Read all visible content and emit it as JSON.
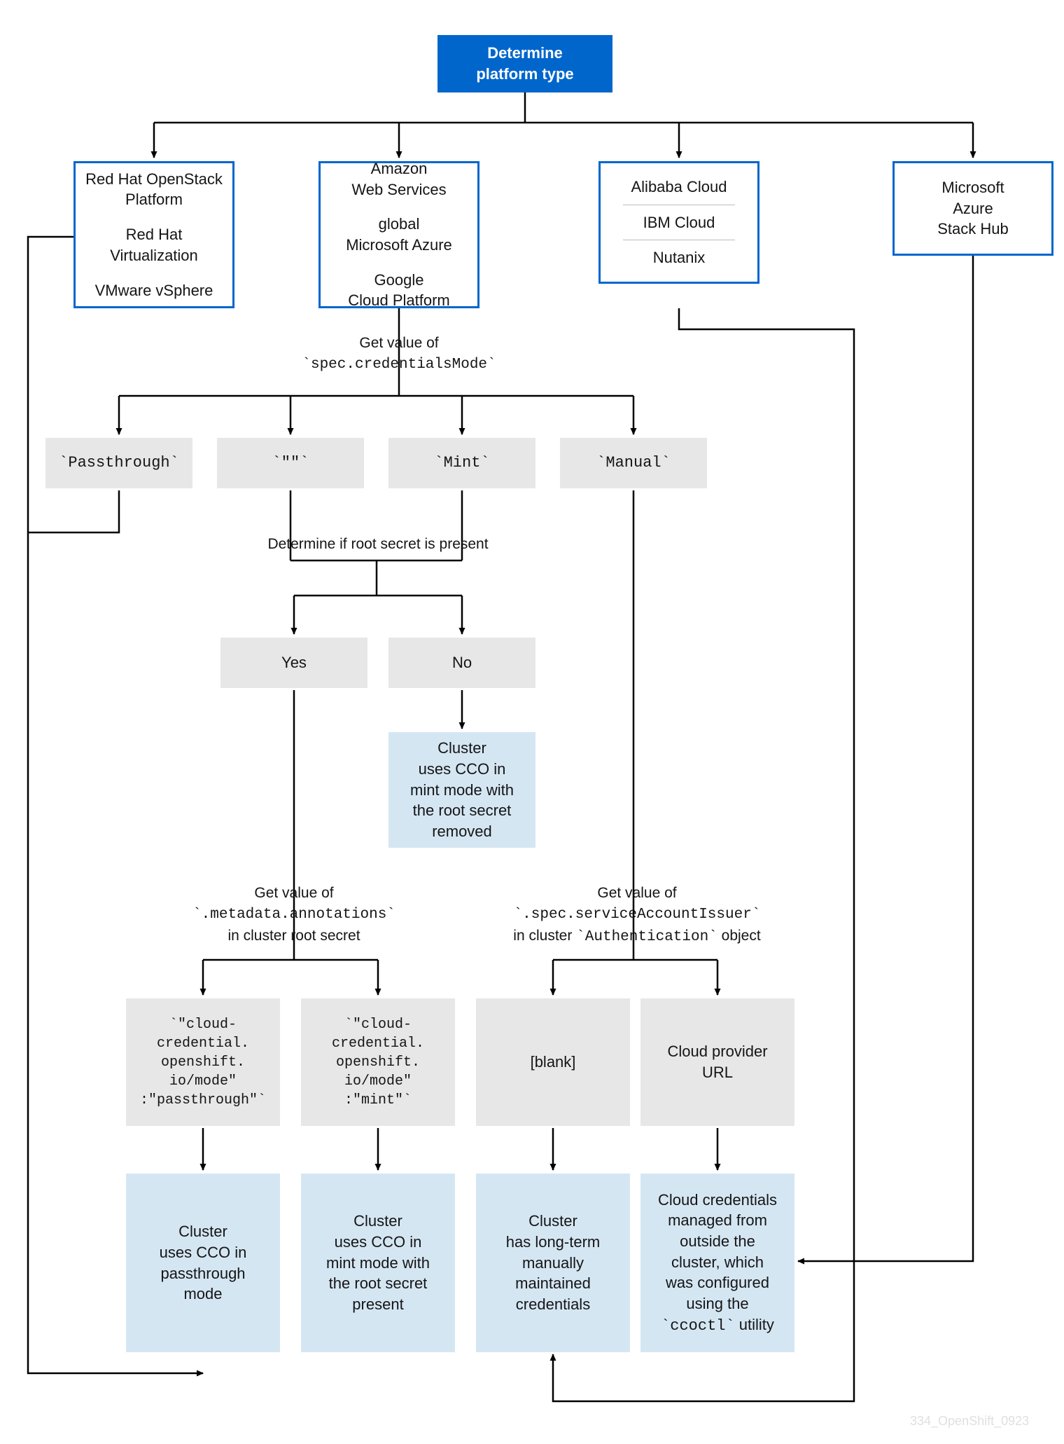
{
  "start": "Determine\nplatform type",
  "platforms": {
    "p1": [
      "Red Hat OpenStack Platform",
      "Red Hat Virtualization",
      "VMware vSphere"
    ],
    "p2": [
      "Amazon\nWeb Services",
      "global\nMicrosoft Azure",
      "Google\nCloud Platform"
    ],
    "p3": [
      "Alibaba Cloud",
      "IBM Cloud",
      "Nutanix"
    ],
    "p4": "Microsoft\nAzure\nStack Hub"
  },
  "labels": {
    "credmode_pre": "Get value of",
    "credmode_code": "`spec.credentialsMode`",
    "rootsecret": "Determine if root secret is present",
    "annotations_pre": "Get value of",
    "annotations_code": "`.metadata.annotations`",
    "annotations_post": "in cluster root secret",
    "issuer_pre": "Get value of",
    "issuer_code": "`.spec.serviceAccountIssuer`",
    "issuer_post_1": "in cluster ",
    "issuer_post_code": "`Authentication`",
    "issuer_post_2": " object"
  },
  "modes": {
    "passthrough": "`Passthrough`",
    "empty": "`\"\"`",
    "mint": "`Mint`",
    "manual": "`Manual`"
  },
  "yesno": {
    "yes": "Yes",
    "no": "No"
  },
  "annot": {
    "pass": "`\"cloud-\ncredential.\nopenshift.\nio/mode\"\n:\"passthrough\"`",
    "mint": "`\"cloud-\ncredential.\nopenshift.\nio/mode\"\n:\"mint\"`"
  },
  "issuer": {
    "blank": "[blank]",
    "url": "Cloud provider\nURL"
  },
  "results": {
    "mint_removed": "Cluster\nuses CCO in\nmint mode with\nthe root secret\nremoved",
    "passthrough": "Cluster\nuses CCO in\npassthrough\nmode",
    "mint_present": "Cluster\nuses CCO in\nmint mode with\nthe root secret\npresent",
    "longterm": "Cluster\nhas long-term\nmanually\nmaintained\ncredentials",
    "ccoctl_pre": "Cloud credentials\nmanaged from\noutside the\ncluster, which\nwas configured\nusing the",
    "ccoctl_code": "`ccoctl`",
    "ccoctl_post": " utility"
  },
  "watermark": "334_OpenShift_0923"
}
